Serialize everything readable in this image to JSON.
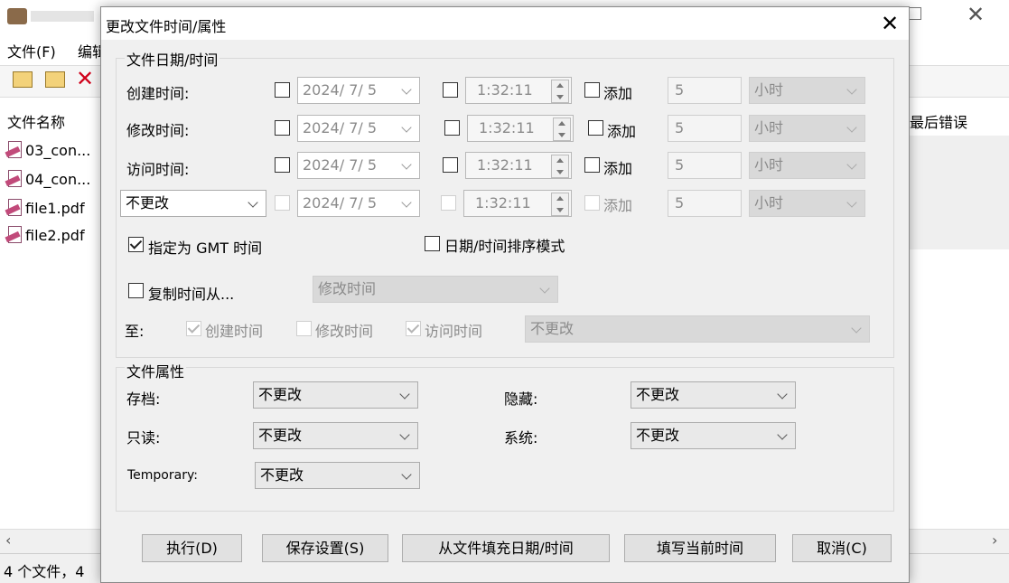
{
  "background": {
    "menu": [
      "文件(F)",
      "编辑"
    ],
    "header": {
      "name_col": "文件名称",
      "last_error_col": "最后错误"
    },
    "files": [
      "03_con...",
      "04_con...",
      "file1.pdf",
      "file2.pdf"
    ],
    "status": "4 个文件，4"
  },
  "dialog": {
    "title": "更改文件时间/属性",
    "datetime_group": {
      "label": "文件日期/时间",
      "rows": [
        {
          "label": "创建时间:",
          "date": "2024/  7/  5",
          "time": "1:32:11",
          "add_label": "添加",
          "amount": "5",
          "unit": "小时"
        },
        {
          "label": "修改时间:",
          "date": "2024/  7/  5",
          "time": "1:32:11",
          "add_label": "添加",
          "amount": "5",
          "unit": "小时"
        },
        {
          "label": "访问时间:",
          "date": "2024/  7/  5",
          "time": "1:32:11",
          "add_label": "添加",
          "amount": "5",
          "unit": "小时"
        },
        {
          "select": "不更改",
          "date": "2024/  7/  5",
          "time": "1:32:11",
          "add_label": "添加",
          "amount": "5",
          "unit": "小时"
        }
      ],
      "gmt_label": "指定为 GMT 时间",
      "gmt_checked": true,
      "sort_mode_label": "日期/时间排序模式",
      "copy_from_label": "复制时间从...",
      "copy_from_select": "修改时间",
      "to_label": "至:",
      "to_options": [
        {
          "label": "创建时间",
          "checked": true
        },
        {
          "label": "修改时间",
          "checked": false
        },
        {
          "label": "访问时间",
          "checked": true
        }
      ],
      "to_select": "不更改"
    },
    "attributes_group": {
      "label": "文件属性",
      "archive_label": "存档:",
      "archive_value": "不更改",
      "readonly_label": "只读:",
      "readonly_value": "不更改",
      "temporary_label": "Temporary:",
      "temporary_value": "不更改",
      "hidden_label": "隐藏:",
      "hidden_value": "不更改",
      "system_label": "系统:",
      "system_value": "不更改"
    },
    "buttons": {
      "execute": "执行(D)",
      "save_settings": "保存设置(S)",
      "fill_from_file": "从文件填充日期/时间",
      "fill_current": "填写当前时间",
      "cancel": "取消(C)"
    }
  }
}
